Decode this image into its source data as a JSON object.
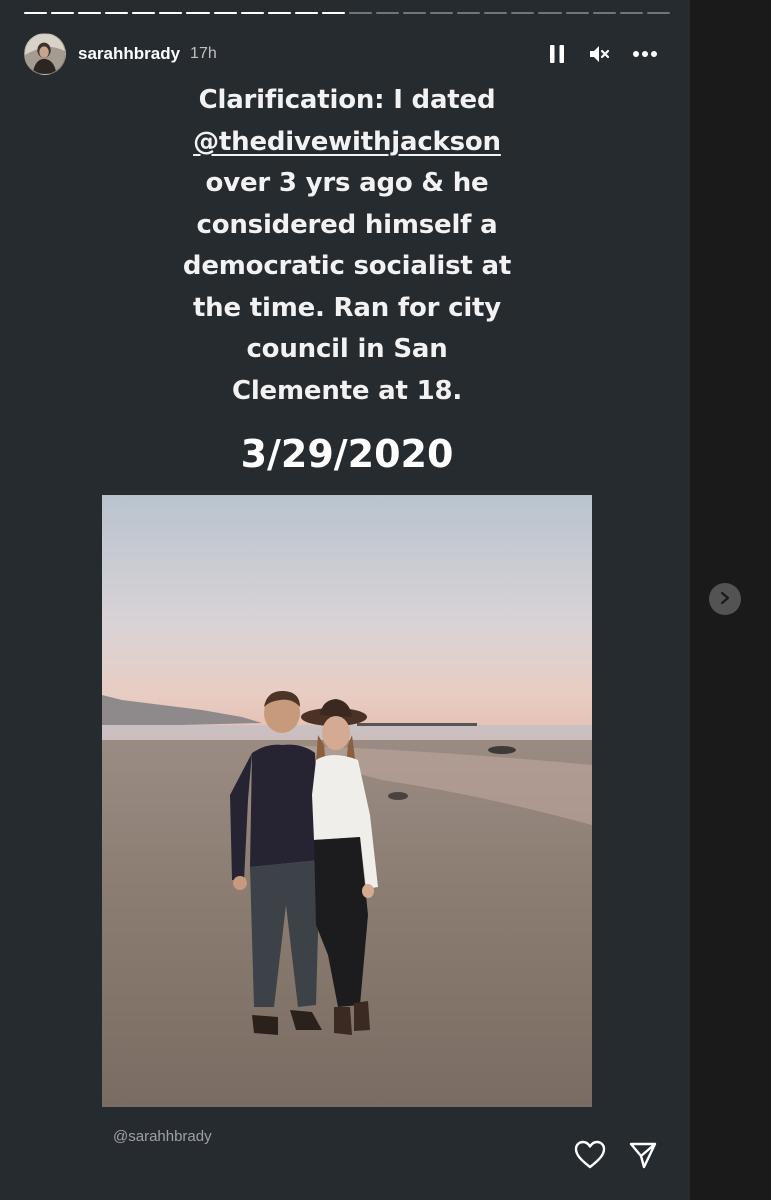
{
  "header": {
    "username": "sarahhbrady",
    "time_ago": "17h",
    "icons": {
      "pause": "pause-icon",
      "mute": "speaker-muted-icon",
      "more": "more-options-icon"
    }
  },
  "progress": {
    "segments": 24,
    "viewed": 12
  },
  "story": {
    "caption_lines": [
      "Clarification: I dated",
      "@thedivewithjackson",
      "over 3 yrs ago & he",
      "considered himself a",
      "democratic socialist at",
      "the time. Ran for city",
      "council in San",
      "Clemente at 18."
    ],
    "date": "3/29/2020",
    "credit": "@sarahhbrady"
  },
  "footer": {
    "icons": {
      "like": "heart-icon",
      "share": "send-icon"
    }
  },
  "navigation": {
    "next": "chevron-right-icon"
  },
  "colors": {
    "story_bg": "#262b30",
    "page_bg": "#1a1a1a",
    "text": "#f2f2f2"
  }
}
